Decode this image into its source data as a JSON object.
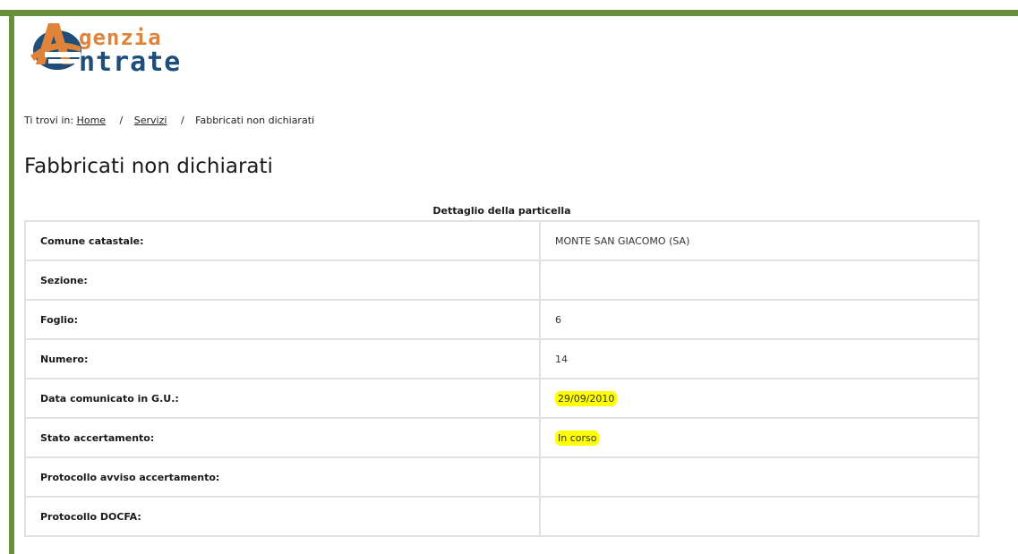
{
  "brand": {
    "logo_line1": "genzia",
    "logo_line2": "ntrate",
    "colors": {
      "frame_green": "#6a8f3a",
      "logo_orange": "#e0833a",
      "logo_blue": "#1f4e7a",
      "highlight": "#ffff00"
    }
  },
  "breadcrumb": {
    "prefix": "Ti trovi in:",
    "items": [
      {
        "label": "Home"
      },
      {
        "label": "Servizi"
      },
      {
        "label": "Fabbricati non dichiarati"
      }
    ],
    "separator": "/"
  },
  "page": {
    "title": "Fabbricati non dichiarati",
    "table_caption": "Dettaglio della particella"
  },
  "detail": {
    "rows": [
      {
        "label": "Comune catastale:",
        "value": "MONTE SAN GIACOMO (SA)",
        "highlighted": false
      },
      {
        "label": "Sezione:",
        "value": "",
        "highlighted": false
      },
      {
        "label": "Foglio:",
        "value": "6",
        "highlighted": false
      },
      {
        "label": "Numero:",
        "value": "14",
        "highlighted": false
      },
      {
        "label": "Data comunicato in G.U.:",
        "value": "29/09/2010",
        "highlighted": true
      },
      {
        "label": "Stato accertamento:",
        "value": "In corso",
        "highlighted": true
      },
      {
        "label": "Protocollo avviso accertamento:",
        "value": "",
        "highlighted": false
      },
      {
        "label": "Protocollo DOCFA:",
        "value": "",
        "highlighted": false
      }
    ]
  }
}
